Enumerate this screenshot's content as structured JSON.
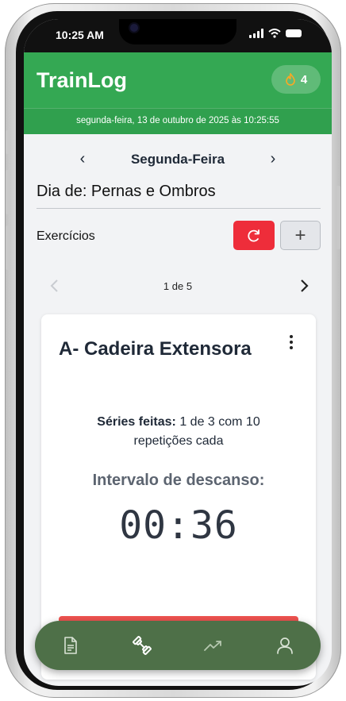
{
  "status": {
    "time": "10:25 AM"
  },
  "header": {
    "app_title": "TrainLog",
    "streak_count": "4",
    "datetime": "segunda-feira, 13 de outubro de 2025 às 10:25:55"
  },
  "day_nav": {
    "prev": "‹",
    "day": "Segunda-Feira",
    "next": "›"
  },
  "workout": {
    "title": "Dia de: Pernas e Ombros",
    "exercises_label": "Exercícios",
    "add_label": "+"
  },
  "pager": {
    "text": "1 de 5",
    "current": 1,
    "total": 5
  },
  "exercise": {
    "name": "A- Cadeira Extensora",
    "series_label": "Séries feitas:",
    "series_text": " 1 de 3 com 10 repetições cada",
    "rest_label": "Intervalo de descanso:",
    "timer": "00:36"
  },
  "bottom_nav": {
    "items": [
      {
        "icon": "document-icon",
        "active": false
      },
      {
        "icon": "dumbbell-icon",
        "active": true
      },
      {
        "icon": "trend-up-icon",
        "active": false
      },
      {
        "icon": "user-icon",
        "active": false
      }
    ]
  },
  "colors": {
    "primary": "#34a853",
    "danger": "#ee2d3a",
    "nav_bg": "#4e7048"
  }
}
